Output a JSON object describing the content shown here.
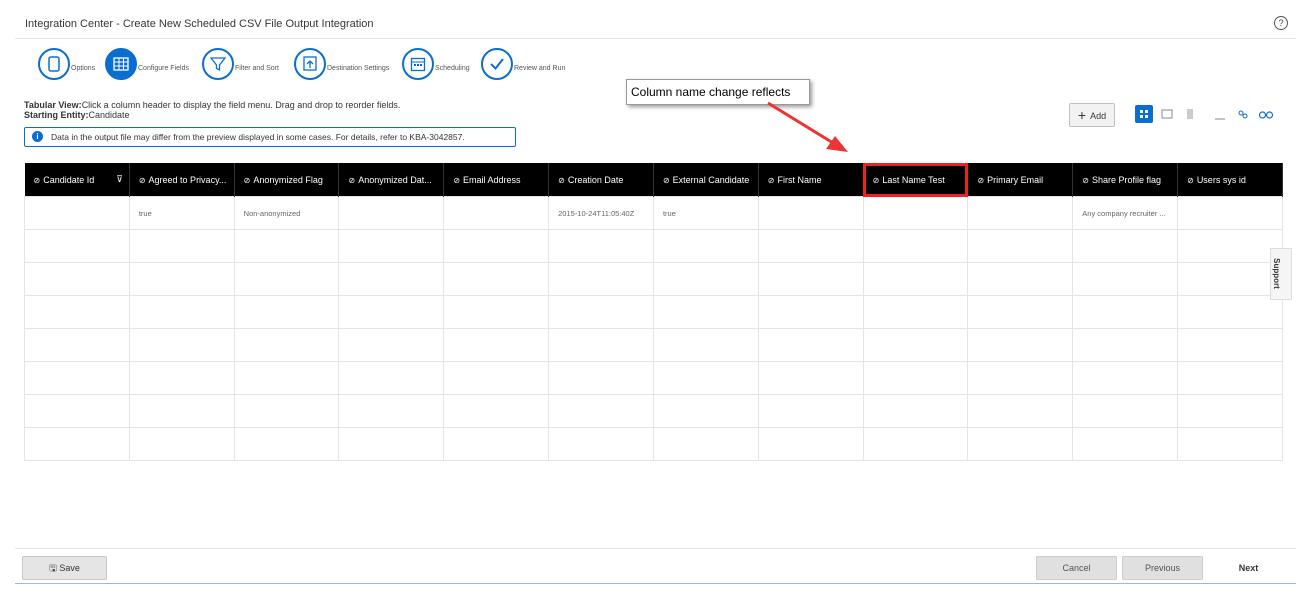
{
  "header": {
    "title": "Integration Center - Create New Scheduled CSV File Output Integration",
    "help_icon": "help-icon"
  },
  "steps": [
    {
      "label": "Options",
      "icon": "document-icon"
    },
    {
      "label": "Configure Fields",
      "icon": "table-icon"
    },
    {
      "label": "Filter and Sort",
      "icon": "filter-icon"
    },
    {
      "label": "Destination Settings",
      "icon": "upload-icon"
    },
    {
      "label": "Scheduling",
      "icon": "calendar-icon"
    },
    {
      "label": "Review and Run",
      "icon": "checkmark-icon"
    }
  ],
  "info": {
    "tabular_label": "Tabular View:",
    "tabular_text": "Click a column header to display the field menu. Drag and drop to reorder fields.",
    "entity_label": "Starting Entity:",
    "entity_value": "Candidate",
    "message": "Data in the output file may differ from the preview displayed in some cases. For details, refer to KBA-3042857."
  },
  "callout": {
    "text": "Column name change reflects"
  },
  "toolbar": {
    "add_label": "Add"
  },
  "table": {
    "columns": [
      "Candidate Id",
      "Agreed to Privacy...",
      "Anonymized Flag",
      "Anonymized Dat...",
      "Email Address",
      "Creation Date",
      "External Candidate",
      "First Name",
      "Last Name Test",
      "Primary Email",
      "Share Profile flag",
      "Users sys id"
    ],
    "rows": [
      [
        "",
        "true",
        "Non-anonymized",
        "",
        "",
        "2015-10-24T11:05:40Z",
        "true",
        "",
        "",
        "",
        "Any company recruiter ...",
        ""
      ],
      [
        "",
        "",
        "",
        "",
        "",
        "",
        "",
        "",
        "",
        "",
        "",
        ""
      ],
      [
        "",
        "",
        "",
        "",
        "",
        "",
        "",
        "",
        "",
        "",
        "",
        ""
      ],
      [
        "",
        "",
        "",
        "",
        "",
        "",
        "",
        "",
        "",
        "",
        "",
        ""
      ],
      [
        "",
        "",
        "",
        "",
        "",
        "",
        "",
        "",
        "",
        "",
        "",
        ""
      ],
      [
        "",
        "",
        "",
        "",
        "",
        "",
        "",
        "",
        "",
        "",
        "",
        ""
      ],
      [
        "",
        "",
        "",
        "",
        "",
        "",
        "",
        "",
        "",
        "",
        "",
        ""
      ],
      [
        "",
        "",
        "",
        "",
        "",
        "",
        "",
        "",
        "",
        "",
        "",
        ""
      ]
    ]
  },
  "support": {
    "label": "Support"
  },
  "footer": {
    "save_label": "Save",
    "cancel_label": "Cancel",
    "previous_label": "Previous",
    "next_label": "Next"
  },
  "colors": {
    "accent": "#0a6ed1",
    "header_bg": "#000000",
    "highlight": "#e22222"
  }
}
